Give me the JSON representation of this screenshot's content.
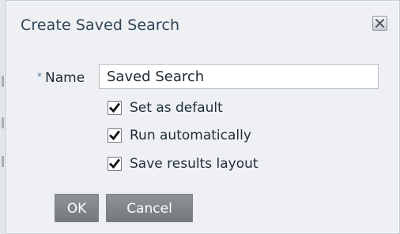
{
  "dialog": {
    "title": "Create Saved Search",
    "close_icon": "close-icon"
  },
  "form": {
    "required_marker": "*",
    "name_label": "Name",
    "name_value": "Saved Search",
    "checkboxes": [
      {
        "label": "Set as default",
        "checked": true
      },
      {
        "label": "Run automatically",
        "checked": true
      },
      {
        "label": "Save results layout",
        "checked": true
      }
    ]
  },
  "buttons": {
    "ok_label": "OK",
    "cancel_label": "Cancel"
  },
  "colors": {
    "dialog_background": "#eef0f3",
    "title_text": "#314556",
    "button_background": "#83888d",
    "required_marker": "#4f77a5"
  }
}
